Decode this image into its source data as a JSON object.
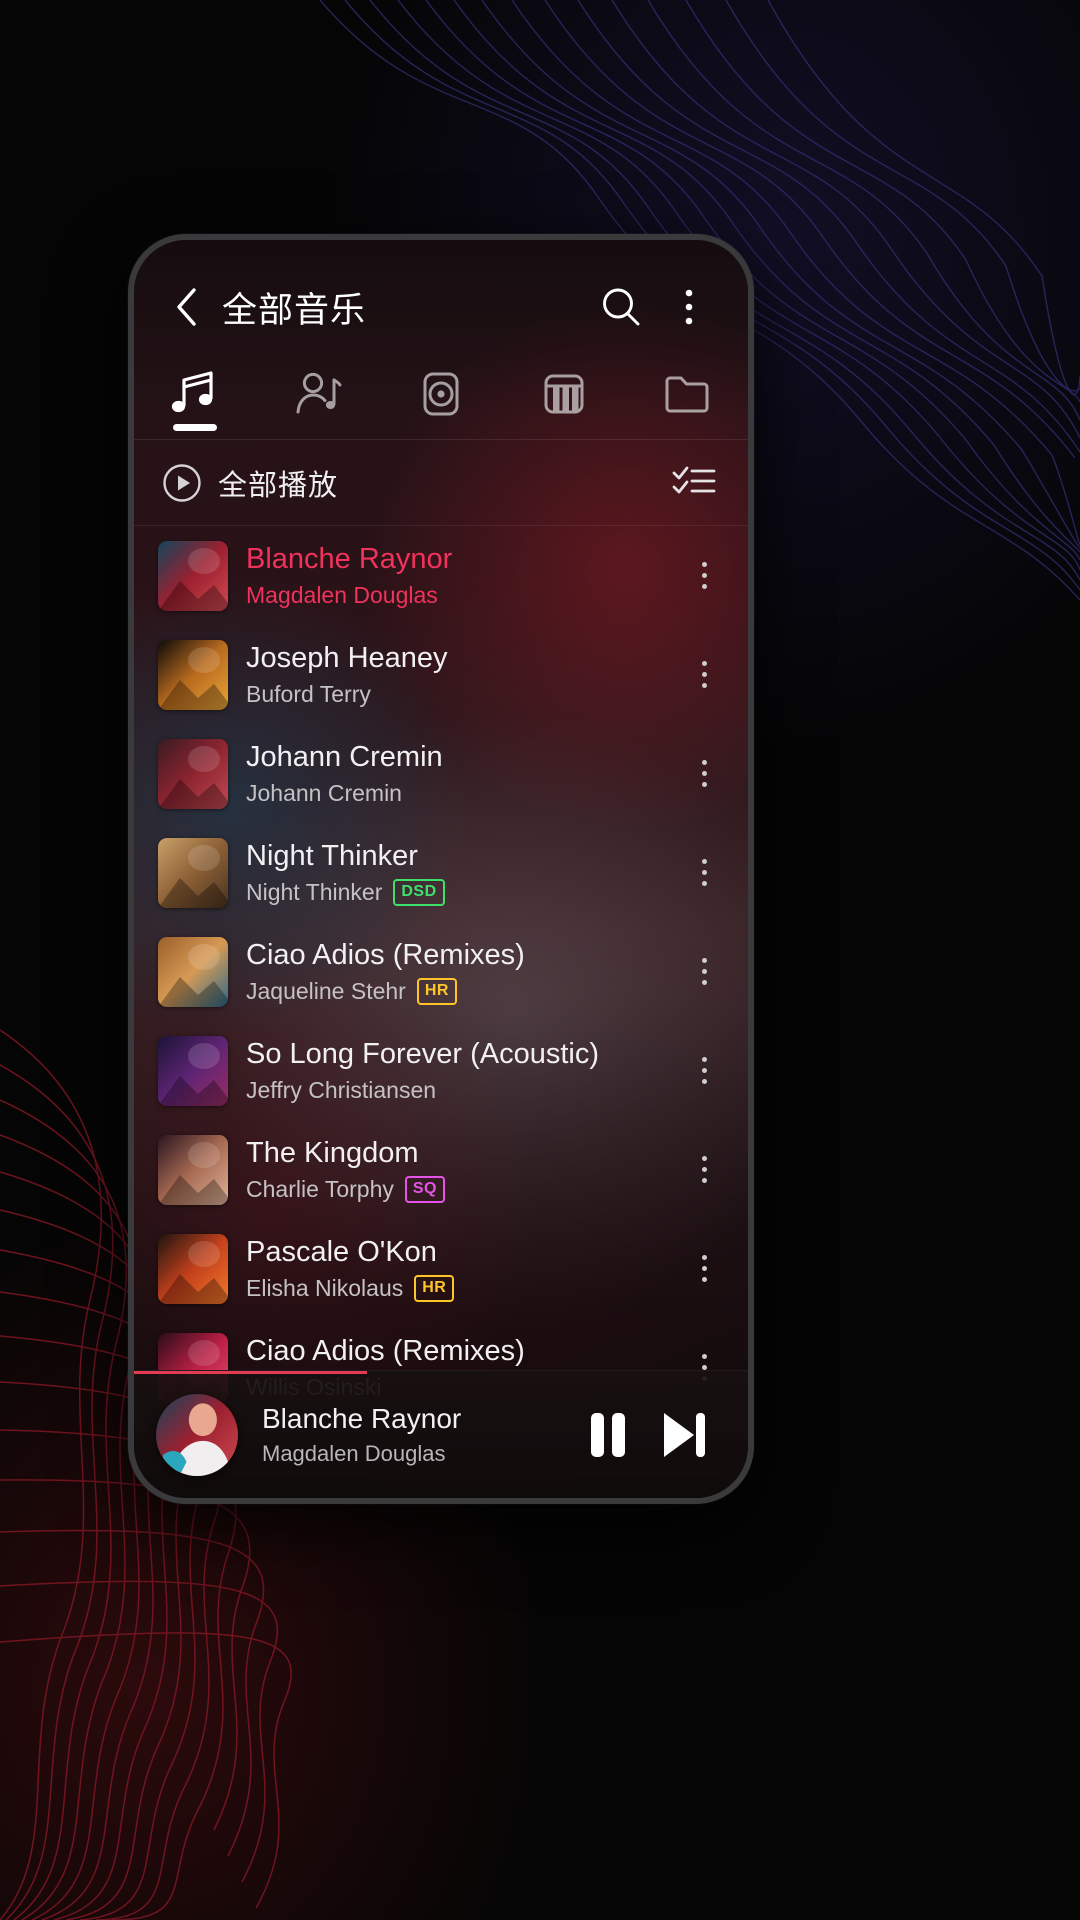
{
  "app": {
    "header": {
      "back_icon": "chevron-left-icon",
      "title": "全部音乐",
      "search_icon": "search-icon",
      "overflow_icon": "more-vertical-icon"
    },
    "tabs": [
      {
        "id": "songs",
        "icon": "music-note-icon",
        "active": true
      },
      {
        "id": "artists",
        "icon": "artist-icon",
        "active": false
      },
      {
        "id": "albums",
        "icon": "album-disc-icon",
        "active": false
      },
      {
        "id": "genres",
        "icon": "piano-keys-icon",
        "active": false
      },
      {
        "id": "folders",
        "icon": "folder-icon",
        "active": false
      }
    ],
    "playall": {
      "play_icon": "play-circle-icon",
      "label": "全部播放",
      "multiselect_icon": "checklist-icon"
    },
    "songs": [
      {
        "title": "Blanche Raynor",
        "artist": "Magdalen Douglas",
        "badge": "",
        "playing": true,
        "menu_icon": "more-vertical-icon",
        "art": "a1"
      },
      {
        "title": "Joseph Heaney",
        "artist": "Buford Terry",
        "badge": "",
        "playing": false,
        "menu_icon": "more-vertical-icon",
        "art": "a2"
      },
      {
        "title": "Johann Cremin",
        "artist": "Johann Cremin",
        "badge": "",
        "playing": false,
        "menu_icon": "more-vertical-icon",
        "art": "a3"
      },
      {
        "title": "Night Thinker",
        "artist": "Night Thinker",
        "badge": "DSD",
        "playing": false,
        "menu_icon": "more-vertical-icon",
        "art": "a4"
      },
      {
        "title": "Ciao Adios (Remixes)",
        "artist": "Jaqueline Stehr",
        "badge": "HR",
        "playing": false,
        "menu_icon": "more-vertical-icon",
        "art": "a5"
      },
      {
        "title": "So Long Forever (Acoustic)",
        "artist": "Jeffry Christiansen",
        "badge": "",
        "playing": false,
        "menu_icon": "more-vertical-icon",
        "art": "a6"
      },
      {
        "title": "The Kingdom",
        "artist": "Charlie Torphy",
        "badge": "SQ",
        "playing": false,
        "menu_icon": "more-vertical-icon",
        "art": "a7"
      },
      {
        "title": "Pascale O'Kon",
        "artist": "Elisha Nikolaus",
        "badge": "HR",
        "playing": false,
        "menu_icon": "more-vertical-icon",
        "art": "a8"
      },
      {
        "title": "Ciao Adios (Remixes)",
        "artist": "Willis Osinski",
        "badge": "",
        "playing": false,
        "menu_icon": "more-vertical-icon",
        "art": "a9"
      }
    ],
    "miniplayer": {
      "title": "Blanche Raynor",
      "artist": "Magdalen Douglas",
      "pause_icon": "pause-icon",
      "next_icon": "skip-next-icon"
    },
    "colors": {
      "accent_playing": "#f0325c",
      "badge_dsd": "#3ee06a",
      "badge_hr": "#ffc428",
      "badge_sq": "#e653e8",
      "progress": "#e43b55"
    }
  }
}
